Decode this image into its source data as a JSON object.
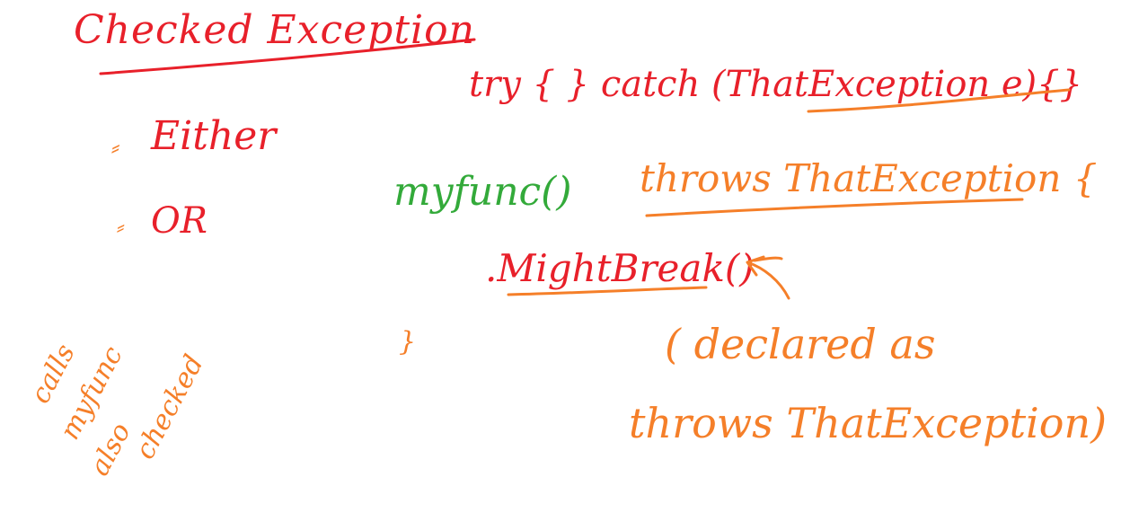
{
  "colors": {
    "red": "#e8202a",
    "orange": "#f57f29",
    "green": "#33aa3a",
    "background": "#ffffff"
  },
  "notes": {
    "title": "Checked Exception",
    "either": "Either",
    "or": "OR",
    "try_catch": "try { } catch (ThatException e){}",
    "signature_func": "myfunc()",
    "signature_throws": "throws ThatException {",
    "call": ".MightBreak()",
    "close_brace": "}",
    "declared_as": "( declared as",
    "throws_that_exception": "throws ThatException)",
    "side_note": [
      "calls",
      "myfunc",
      "also",
      "checked"
    ]
  }
}
